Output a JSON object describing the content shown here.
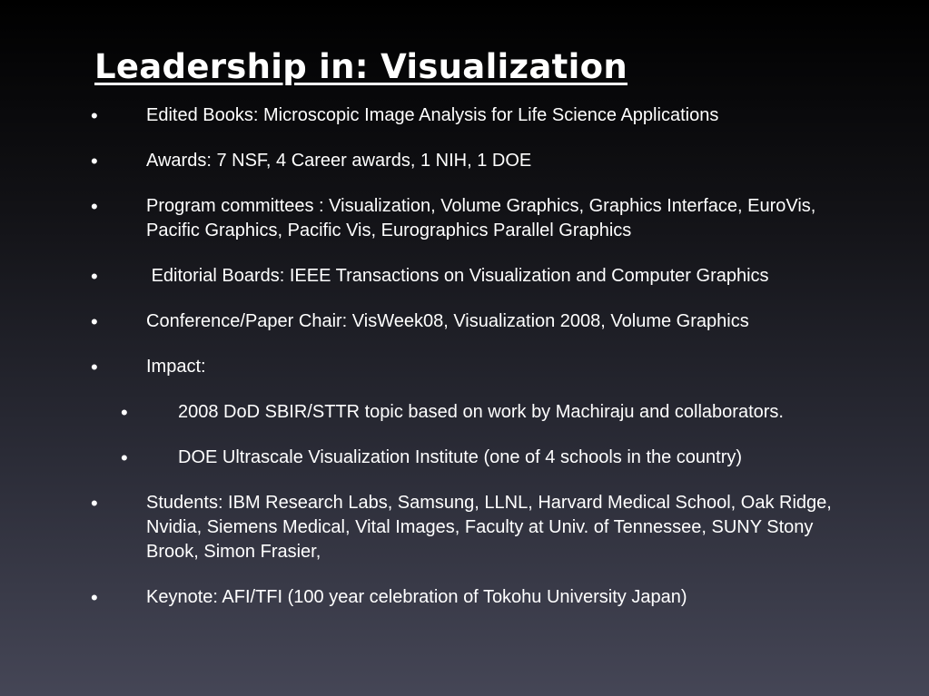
{
  "slide": {
    "title": "Leadership in: Visualization",
    "bullet_glyph": "•",
    "items": [
      {
        "level": 1,
        "text": "Edited Books:  Microscopic Image Analysis for Life Science Applications"
      },
      {
        "level": 1,
        "text": "Awards: 7 NSF, 4 Career awards, 1 NIH, 1 DOE"
      },
      {
        "level": 1,
        "text": "Program committees : Visualization, Volume Graphics, Graphics Interface, EuroVis, Pacific Graphics,  Pacific Vis, Eurographics Parallel Graphics"
      },
      {
        "level": 1,
        "text": " Editorial Boards: IEEE Transactions on Visualization and Computer Graphics"
      },
      {
        "level": 1,
        "text": "Conference/Paper Chair: VisWeek08, Visualization 2008, Volume Graphics"
      },
      {
        "level": 1,
        "text": "Impact:"
      },
      {
        "level": 2,
        "text": "2008 DoD SBIR/STTR topic based on work by Machiraju and collaborators."
      },
      {
        "level": 2,
        "text": "DOE Ultrascale Visualization Institute (one of 4 schools in the country)"
      },
      {
        "level": 1,
        "text": "Students:  IBM Research Labs, Samsung, LLNL, Harvard Medical School, Oak Ridge, Nvidia, Siemens Medical, Vital Images, Faculty at Univ. of Tennessee, SUNY Stony Brook, Simon Frasier,"
      },
      {
        "level": 1,
        "text": "Keynote: AFI/TFI (100 year celebration of Tokohu University Japan)"
      }
    ]
  },
  "colors": {
    "text": "#ffffff",
    "background_top": "#000000",
    "background_bottom": "#454656"
  }
}
